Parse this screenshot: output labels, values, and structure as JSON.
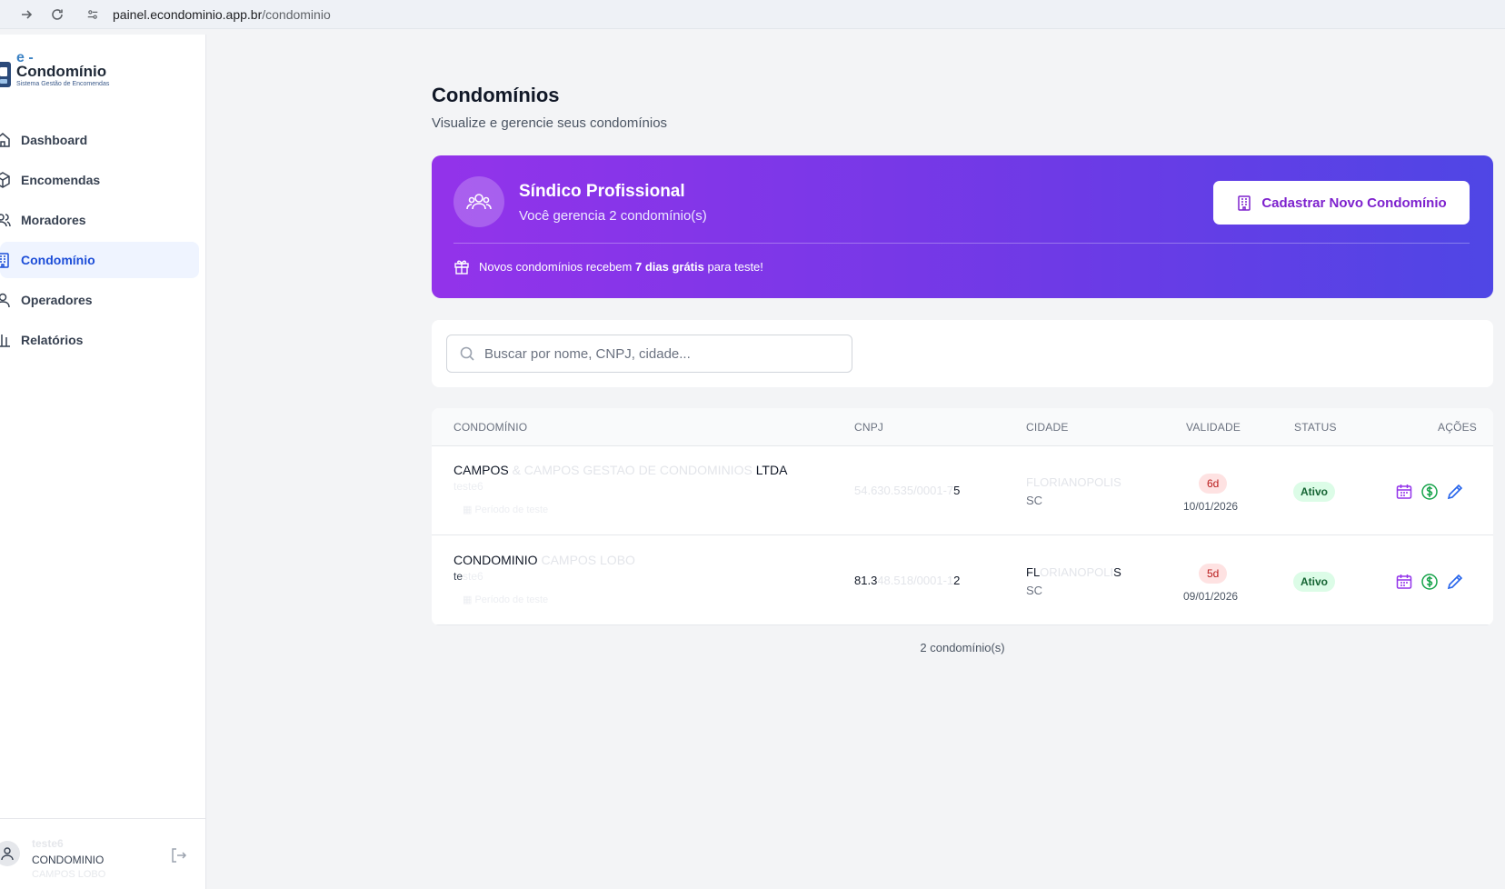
{
  "browser": {
    "url_domain": "painel.econdominio.app.br",
    "url_path": "/condominio"
  },
  "logo": {
    "prefix": "e -",
    "name": "Condomínio",
    "tagline": "Sistema Gestão de Encomendas"
  },
  "sidebar": {
    "items": [
      {
        "label": "Dashboard",
        "icon": "home-icon",
        "active": false
      },
      {
        "label": "Encomendas",
        "icon": "package-icon",
        "active": false
      },
      {
        "label": "Moradores",
        "icon": "users-icon",
        "active": false
      },
      {
        "label": "Condomínio",
        "icon": "building-icon",
        "active": true
      },
      {
        "label": "Operadores",
        "icon": "user-icon",
        "active": false
      },
      {
        "label": "Relatórios",
        "icon": "bar-chart-icon",
        "active": false
      }
    ],
    "user": {
      "name_faded": "teste6",
      "condo_line": "CONDOMINIO",
      "condo_faded": "CAMPOS LOBO"
    }
  },
  "page": {
    "title": "Condomínios",
    "subtitle": "Visualize e gerencie seus condomínios"
  },
  "banner": {
    "title": "Síndico Profissional",
    "subtitle": "Você gerencia 2 condomínio(s)",
    "button_label": "Cadastrar Novo Condomínio",
    "promo_before": "Novos condomínios recebem ",
    "promo_bold": "7 dias grátis",
    "promo_after": " para teste!"
  },
  "search": {
    "placeholder": "Buscar por nome, CNPJ, cidade..."
  },
  "table": {
    "headers": {
      "name": "CONDOMÍNIO",
      "cnpj": "CNPJ",
      "city": "CIDADE",
      "validity": "VALIDADE",
      "status": "STATUS",
      "actions": "AÇÕES"
    },
    "rows": [
      {
        "name_start": "CAMPOS",
        "name_faded": " & CAMPOS GESTAO DE CONDOMINIOS ",
        "name_end": "LTDA",
        "sub_visible": "",
        "sub_faded": "teste6",
        "trial": "Período de teste",
        "cnpj_visible": "",
        "cnpj_faded": "54.630.535/0001-7",
        "cnpj_end": "5",
        "city_visible": "",
        "city_faded": "FLORIANOPOLIS",
        "city_end": "",
        "state": "SC",
        "days": "6d",
        "date": "10/01/2026",
        "status": "Ativo"
      },
      {
        "name_start": "CONDOMINIO",
        "name_faded": " CAMPOS LOBO",
        "name_end": "",
        "sub_visible": "te",
        "sub_faded": "ste6",
        "trial": "Período de teste",
        "cnpj_visible": "81.3",
        "cnpj_faded": "48.518/0001-1",
        "cnpj_end": "2",
        "city_visible": "FL",
        "city_faded": "ORIANOPOLI",
        "city_end": "S",
        "state": "SC",
        "days": "5d",
        "date": "09/01/2026",
        "status": "Ativo"
      }
    ],
    "count_label": "2 condomínio(s)"
  },
  "colors": {
    "accent": "#1d4ed8",
    "banner_start": "#9333ea",
    "banner_end": "#4f46e5",
    "status_green": "#166534",
    "days_red": "#b91c1c"
  }
}
